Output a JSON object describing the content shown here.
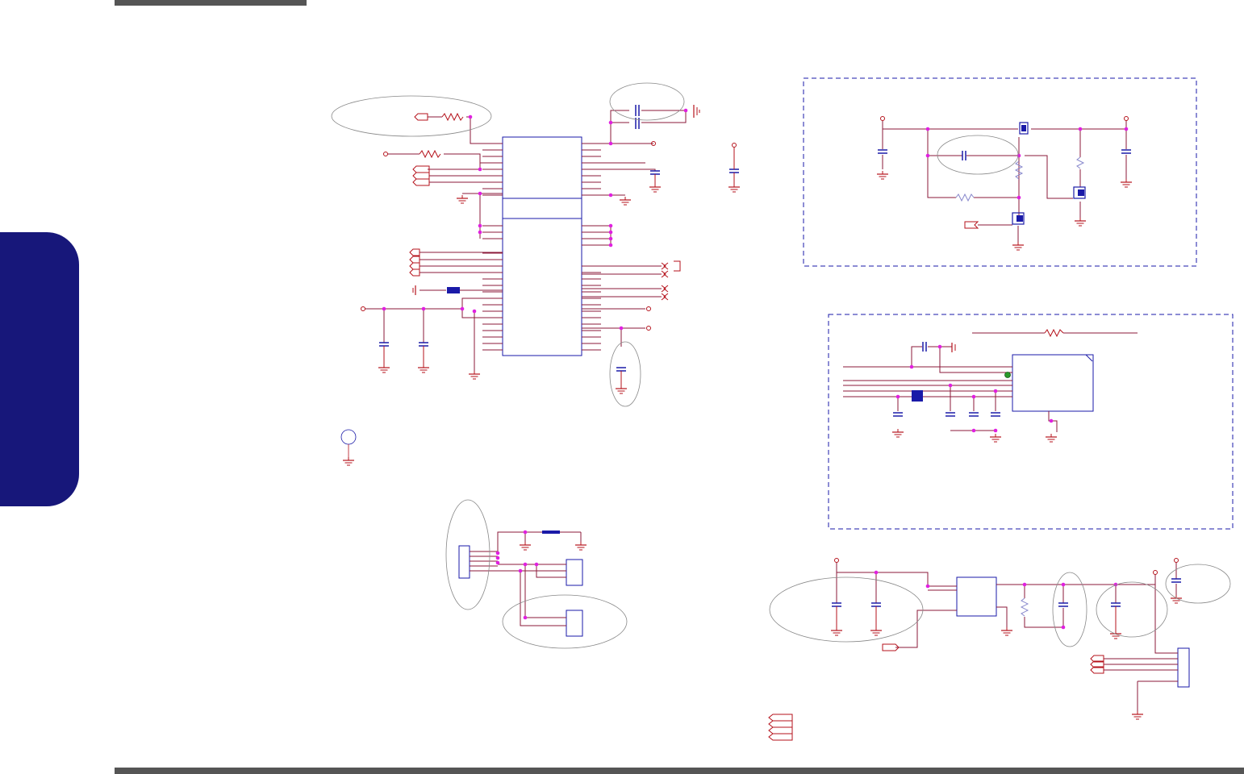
{
  "colors": {
    "wire": "#8b1a3a",
    "net": "#b5121b",
    "part": "#1a1aa8",
    "node": "#e020e0",
    "highlight": "#888888",
    "tab": "#17177a",
    "bar": "#555555",
    "test_point": "#2a9a2a"
  },
  "labels": {}
}
